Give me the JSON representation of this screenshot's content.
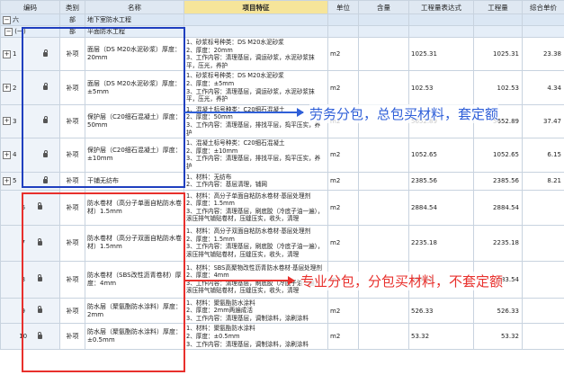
{
  "headers": {
    "c0": "编码",
    "c1": "类别",
    "c2": "名称",
    "c3": "项目特征",
    "c4": "单位",
    "c5": "含量",
    "c6": "工程量表达式",
    "c7": "工程量",
    "c8": "综合单价"
  },
  "section": {
    "code": "六",
    "cat": "部",
    "name": "地下室防水工程"
  },
  "subsection": {
    "code": "(一)",
    "cat": "部",
    "name": "平面防水工程"
  },
  "rows": [
    {
      "code": "1",
      "cat": "补项",
      "name": "面层（DS M20水泥砂浆）厚度：20mm",
      "feat": "1、砂浆标号种类：DS M20水泥砂浆\n2、厚度：20mm\n3、工作内容：清理基层，调运砂浆，水泥砂浆抹平，压光，养护",
      "unit": "m2",
      "expr": "1025.31",
      "qty": "1025.31",
      "price": "23.38"
    },
    {
      "code": "2",
      "cat": "补项",
      "name": "面层（DS M20水泥砂浆）厚度：±5mm",
      "feat": "1、砂浆标号种类：DS M20水泥砂浆\n2、厚度：±5mm\n3、工作内容：清理基层，调运砂浆，水泥砂浆抹平，压光，养护",
      "unit": "m2",
      "expr": "102.53",
      "qty": "102.53",
      "price": "4.34"
    },
    {
      "code": "3",
      "cat": "补项",
      "name": "保护层（C20细石混凝土）厚度：50mm",
      "feat": "1、混凝土标号种类：C20细石混凝土\n2、厚度：50mm\n3、工作内容：清理基层，排找平层，捣平压实，养护",
      "unit": "m2",
      "expr": "5652.89",
      "qty": "5652.89",
      "price": "37.47"
    },
    {
      "code": "4",
      "cat": "补项",
      "name": "保护层（C20细石混凝土）厚度：±10mm",
      "feat": "1、混凝土标号种类：C20细石混凝土\n2、厚度：±10mm\n3、工作内容：清理基层，排找平层，捣平压实，养护",
      "unit": "m2",
      "expr": "1052.65",
      "qty": "1052.65",
      "price": "6.15"
    },
    {
      "code": "5",
      "cat": "补项",
      "name": "干铺无纺布",
      "feat": "1、材料：无纺布\n2、工作内容：基层清理，铺网",
      "unit": "m2",
      "expr": "2385.56",
      "qty": "2385.56",
      "price": "8.21"
    },
    {
      "code": "6",
      "cat": "补项",
      "name": "防水卷材（高分子单面自粘防水卷材）1.5mm",
      "feat": "1、材料：高分子单面自粘防水卷材·基层处理剂\n2、厚度：1.5mm\n3、工作内容：清理基层，刷底胶（冷底子油一遍），滚压排气铺贴卷材，压缝压实，收头，清理",
      "unit": "m2",
      "expr": "2884.54",
      "qty": "2884.54",
      "price": ""
    },
    {
      "code": "7",
      "cat": "补项",
      "name": "防水卷材（高分子双面自粘防水卷材）1.5mm",
      "feat": "1、材料：高分子双面自粘防水卷材·基层处理剂\n2、厚度：1.5mm\n3、工作内容：清理基层，刷底胶（冷底子油一遍），滚压排气铺贴卷材，压缝压实，收头，清理",
      "unit": "m2",
      "expr": "2235.18",
      "qty": "2235.18",
      "price": ""
    },
    {
      "code": "8",
      "cat": "补项",
      "name": "防水卷材（SBS改性沥青卷材）厚度：4mm",
      "feat": "1、材料：SBS高聚物改性沥青防水卷材·基层处理剂\n2、厚度：4mm\n3、工作内容：清理基层，刷底胶（冷底子油一遍），滚压排气铺贴卷材，压缝压实，收头，清理",
      "unit": "m2",
      "expr": "683.54",
      "qty": "683.54",
      "price": ""
    },
    {
      "code": "9",
      "cat": "补项",
      "name": "防水层（聚氨酯防水涂料）厚度：2mm",
      "feat": "1、材料：聚氨酯防水涂料\n2、厚度：2mm两遍成活\n3、工作内容：清理基层，调制涂料，涂刷涂料",
      "unit": "m2",
      "expr": "526.33",
      "qty": "526.33",
      "price": ""
    },
    {
      "code": "10",
      "cat": "补项",
      "name": "防水层（聚氨酯防水涂料）厚度：±0.5mm",
      "feat": "1、材料：聚氨酯防水涂料\n2、厚度：±0.5mm\n3、工作内容：清理基层，调制涂料，涂刷涂料",
      "unit": "m2",
      "expr": "53.32",
      "qty": "53.32",
      "price": ""
    }
  ],
  "annotations": {
    "blue": "劳务分包，总包买材料，套定额",
    "red": "专业分包，分包买材料，不套定额"
  },
  "colors": {
    "blue": "#1f3fbf",
    "red": "#e8302c"
  }
}
